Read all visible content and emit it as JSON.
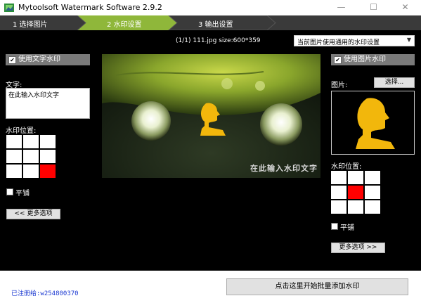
{
  "window": {
    "title": "Mytoolsoft Watermark Software 2.9.2",
    "minimize": "—",
    "maximize": "☐",
    "close": "✕"
  },
  "steps": [
    {
      "label": "1  选择图片"
    },
    {
      "label": "2  水印设置"
    },
    {
      "label": "3  输出设置"
    }
  ],
  "file_info": "(1/1) 111.jpg size:600*359",
  "apply_dropdown": {
    "selected": "当前图片使用通用的水印设置"
  },
  "text_watermark": {
    "toggle_label": "使用文字水印",
    "checked": true,
    "text_label": "文字:",
    "text_value": "在此输入水印文字",
    "position_label": "水印位置:",
    "position_selected": "bottom-right",
    "tile_label": "平铺",
    "more_options": "<< 更多选项"
  },
  "image_watermark": {
    "toggle_label": "使用图片水印",
    "checked": true,
    "image_label": "图片:",
    "browse_button": "选择...",
    "position_label": "水印位置:",
    "position_selected": "center",
    "tile_label": "平铺",
    "more_options": "更多选项 >>"
  },
  "preview": {
    "overlay_text": "在此输入水印文字"
  },
  "footer": {
    "registration": "已注册给:w254800370",
    "start_button": "点击这里开始批量添加水印"
  },
  "colors": {
    "selected_cell": "#ff0000",
    "registration_text": "#1a38d1",
    "watermark_logo": "#f2b70c"
  }
}
